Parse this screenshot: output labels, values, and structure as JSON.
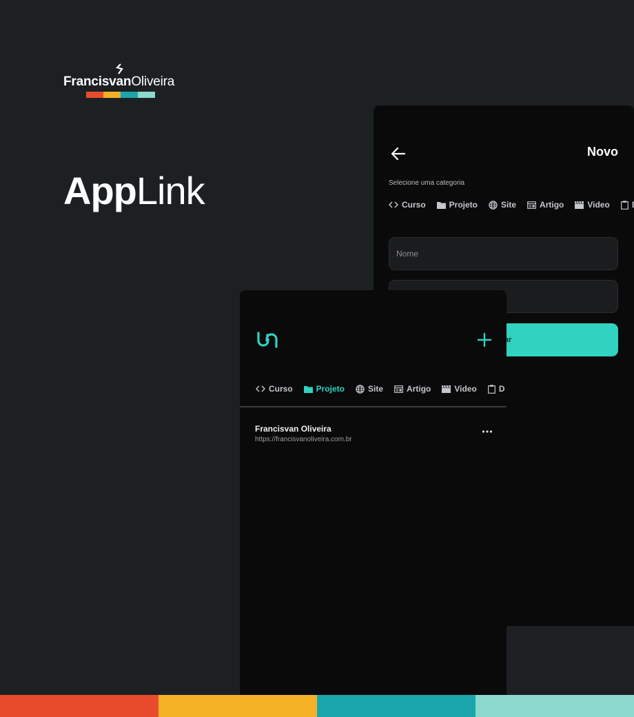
{
  "brand": {
    "name_bold": "Francisvan",
    "name_regular": "Oliveira",
    "mark_icon": "brand-mark-icon",
    "bar_colors": [
      "#e84c2d",
      "#f4b125",
      "#1aa6ad",
      "#8dd8cc"
    ]
  },
  "title": {
    "bold": "App",
    "regular": "Link"
  },
  "colors": {
    "background": "#1d2023",
    "screen": "#0a0a0b",
    "accent": "#2fd3c0"
  },
  "new_screen": {
    "back_icon": "arrow-left-icon",
    "title": "Novo",
    "category_label": "Selecione uma categoria",
    "categories": [
      {
        "label": "Curso",
        "icon": "code-icon"
      },
      {
        "label": "Projeto",
        "icon": "folder-icon"
      },
      {
        "label": "Site",
        "icon": "globe-icon"
      },
      {
        "label": "Artigo",
        "icon": "article-icon"
      },
      {
        "label": "Video",
        "icon": "clapperboard-icon"
      },
      {
        "label": "Do",
        "icon": "clipboard-icon"
      }
    ],
    "name_placeholder": "Nome",
    "submit_label": "onar"
  },
  "list_screen": {
    "logo_icon": "applink-logo-icon",
    "add_icon": "plus-icon",
    "categories": [
      {
        "label": "Curso",
        "icon": "code-icon",
        "active": false
      },
      {
        "label": "Projeto",
        "icon": "folder-icon",
        "active": true
      },
      {
        "label": "Site",
        "icon": "globe-icon",
        "active": false
      },
      {
        "label": "Artigo",
        "icon": "article-icon",
        "active": false
      },
      {
        "label": "Video",
        "icon": "clapperboard-icon",
        "active": false
      },
      {
        "label": "D",
        "icon": "clipboard-icon",
        "active": false
      }
    ],
    "items": [
      {
        "title": "Francisvan Oliveira",
        "url": "https://francisvanoliveira.com.br"
      }
    ],
    "more_icon": "more-horizontal-icon"
  },
  "footer_strip_colors": [
    "#e84c2d",
    "#f4b125",
    "#1aa6ad",
    "#8dd8cc"
  ]
}
